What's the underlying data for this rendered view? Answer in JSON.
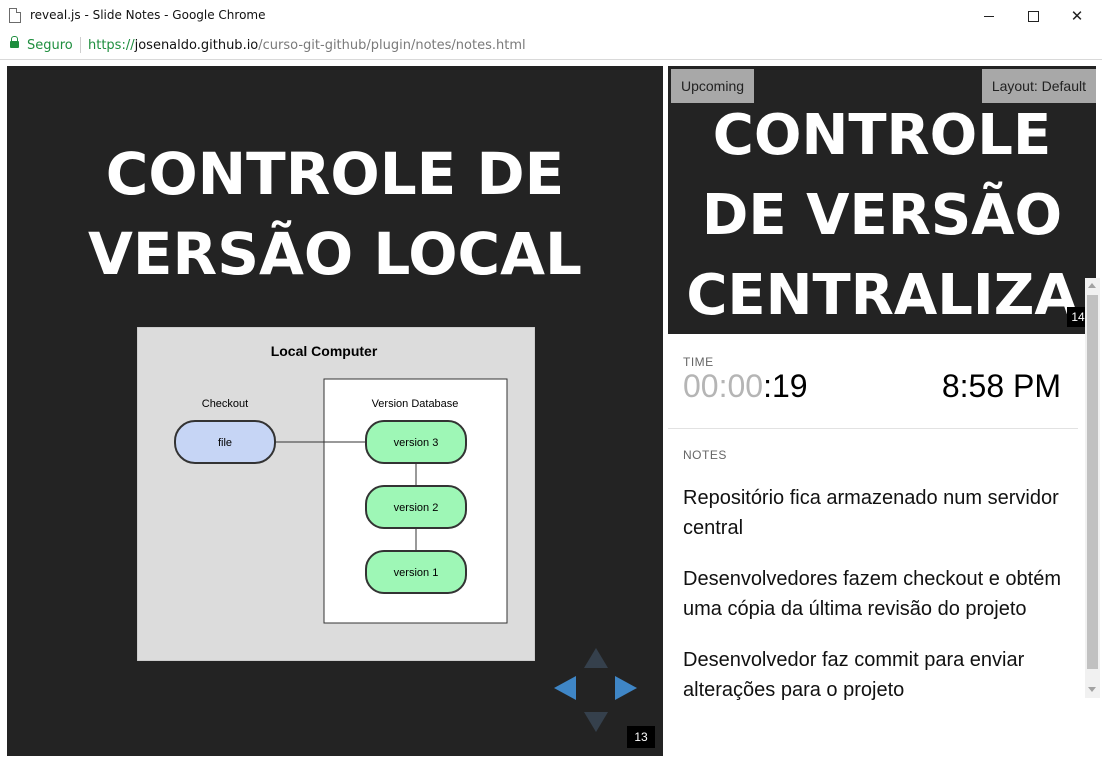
{
  "window": {
    "title": "reveal.js - Slide Notes - Google Chrome",
    "minimize_icon": "minimize-icon",
    "maximize_icon": "maximize-icon",
    "close_label": "✕"
  },
  "address_bar": {
    "secure_label": "Seguro",
    "url_scheme": "https://",
    "url_host": "josenaldo.github.io",
    "url_path": "/curso-git-github/plugin/notes/notes.html"
  },
  "current_slide": {
    "title_lines": [
      "CONTROLE DE",
      "VERSÃO LOCAL"
    ],
    "slide_number": "13",
    "diagram": {
      "title": "Local Computer",
      "checkout_label": "Checkout",
      "file_label": "file",
      "database_label": "Version Database",
      "versions": [
        "version 3",
        "version 2",
        "version 1"
      ]
    },
    "colors": {
      "background": "#232323",
      "arrow_active": "#3f86c6",
      "arrow_inactive": "#35404c"
    }
  },
  "upcoming": {
    "label": "Upcoming",
    "layout_button": "Layout: Default",
    "title_lines": [
      "CONTROLE",
      "DE VERSÃO",
      "CENTRALIZA"
    ],
    "slide_number": "14"
  },
  "info": {
    "time_label": "TIME",
    "timer_dim": "00:00",
    "timer_rest": ":19",
    "clock": "8:58 PM",
    "notes_label": "NOTES",
    "notes": [
      "Repositório fica armazenado num servidor central",
      "Desenvolvedores fazem checkout e obtém uma cópia da última revisão do projeto",
      "Desenvolvedor faz commit para enviar alterações para o projeto"
    ]
  }
}
